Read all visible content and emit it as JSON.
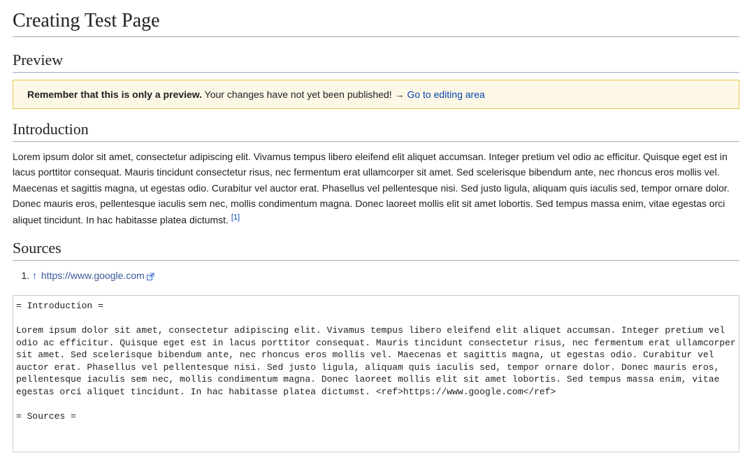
{
  "page_title": "Creating Test Page",
  "preview_heading": "Preview",
  "preview_note": {
    "bold": "Remember that this is only a preview.",
    "rest": " Your changes have not yet been published! ",
    "arrow": "→ ",
    "link_text": "Go to editing area"
  },
  "introduction_heading": "Introduction",
  "introduction_body": "Lorem ipsum dolor sit amet, consectetur adipiscing elit. Vivamus tempus libero eleifend elit aliquet accumsan. Integer pretium vel odio ac efficitur. Quisque eget est in lacus porttitor consequat. Mauris tincidunt consectetur risus, nec fermentum erat ullamcorper sit amet. Sed scelerisque bibendum ante, nec rhoncus eros mollis vel. Maecenas et sagittis magna, ut egestas odio. Curabitur vel auctor erat. Phasellus vel pellentesque nisi. Sed justo ligula, aliquam quis iaculis sed, tempor ornare dolor. Donec mauris eros, pellentesque iaculis sem nec, mollis condimentum magna. Donec laoreet mollis elit sit amet lobortis. Sed tempus massa enim, vitae egestas orci aliquet tincidunt. In hac habitasse platea dictumst. ",
  "ref_marker": "[1]",
  "sources_heading": "Sources",
  "references": [
    {
      "backlink": "↑",
      "url_text": "https://www.google.com"
    }
  ],
  "editor_text": "= Introduction =\n\nLorem ipsum dolor sit amet, consectetur adipiscing elit. Vivamus tempus libero eleifend elit aliquet accumsan. Integer pretium vel odio ac efficitur. Quisque eget est in lacus porttitor consequat. Mauris tincidunt consectetur risus, nec fermentum erat ullamcorper sit amet. Sed scelerisque bibendum ante, nec rhoncus eros mollis vel. Maecenas et sagittis magna, ut egestas odio. Curabitur vel auctor erat. Phasellus vel pellentesque nisi. Sed justo ligula, aliquam quis iaculis sed, tempor ornare dolor. Donec mauris eros, pellentesque iaculis sem nec, mollis condimentum magna. Donec laoreet mollis elit sit amet lobortis. Sed tempus massa enim, vitae egestas orci aliquet tincidunt. In hac habitasse platea dictumst. <ref>https://www.google.com</ref>\n\n= Sources =\n"
}
